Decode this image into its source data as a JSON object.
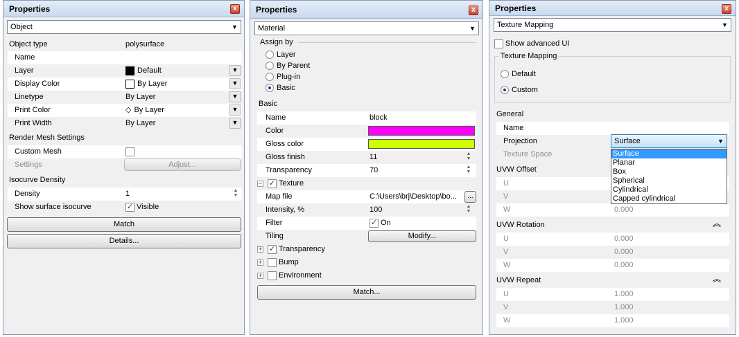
{
  "panel1": {
    "title": "Properties",
    "close": "x",
    "category": "Object",
    "object_type_label": "Object type",
    "object_type_value": "polysurface",
    "rows": [
      {
        "label": "Name",
        "value": ""
      },
      {
        "label": "Layer",
        "value": "Default"
      },
      {
        "label": "Display Color",
        "value": "By Layer"
      },
      {
        "label": "Linetype",
        "value": "By Layer"
      },
      {
        "label": "Print Color",
        "value": "By Layer"
      },
      {
        "label": "Print Width",
        "value": "By Layer"
      }
    ],
    "render_mesh_header": "Render Mesh Settings",
    "custom_mesh_label": "Custom Mesh",
    "settings_label": "Settings",
    "adjust_label": "Adjust...",
    "isocurve_header": "Isocurve Density",
    "density_label": "Density",
    "density_value": "1",
    "show_iso_label": "Show surface isocurve",
    "show_iso_value": "Visible",
    "match_label": "Match",
    "details_label": "Details...",
    "layer_color": "#000000"
  },
  "panel2": {
    "title": "Properties",
    "close": "x",
    "category": "Material",
    "assign_by_header": "Assign by",
    "assign_options": [
      "Layer",
      "By Parent",
      "Plug-in",
      "Basic"
    ],
    "basic_header": "Basic",
    "name_label": "Name",
    "name_value": "block",
    "color_label": "Color",
    "color_value": "#ff00ff",
    "gloss_color_label": "Gloss color",
    "gloss_color_value": "#ccff00",
    "gloss_finish_label": "Gloss finish",
    "gloss_finish_value": "11",
    "transparency_label": "Transparency",
    "transparency_value": "70",
    "texture_label": "Texture",
    "map_file_label": "Map file",
    "map_file_value": "C:\\Users\\brj\\Desktop\\bo...",
    "browse_label": "...",
    "intensity_label": "Intensity, %",
    "intensity_value": "100",
    "filter_label": "Filter",
    "filter_value": "On",
    "tiling_label": "Tiling",
    "modify_label": "Modify...",
    "tree_transparency": "Transparency",
    "tree_bump": "Bump",
    "tree_environment": "Environment",
    "match_label": "Match..."
  },
  "panel3": {
    "title": "Properties",
    "close": "x",
    "category": "Texture Mapping",
    "show_advanced": "Show advanced UI",
    "tm_group": "Texture Mapping",
    "tm_options": [
      "Default",
      "Custom"
    ],
    "general_header": "General",
    "name_label": "Name",
    "projection_label": "Projection",
    "projection_value": "Surface",
    "texture_space_label": "Texture Space",
    "projection_options": [
      "Surface",
      "Planar",
      "Box",
      "Spherical",
      "Cylindrical",
      "Capped cylindrical"
    ],
    "uvw_offset_header": "UVW Offset",
    "offset": [
      {
        "label": "U",
        "value": ""
      },
      {
        "label": "V",
        "value": ""
      },
      {
        "label": "W",
        "value": "0.000"
      }
    ],
    "uvw_rotation_header": "UVW Rotation",
    "rotation": [
      {
        "label": "U",
        "value": "0.000"
      },
      {
        "label": "V",
        "value": "0.000"
      },
      {
        "label": "W",
        "value": "0.000"
      }
    ],
    "uvw_repeat_header": "UVW Repeat",
    "repeat": [
      {
        "label": "U",
        "value": "1.000"
      },
      {
        "label": "V",
        "value": "1.000"
      },
      {
        "label": "W",
        "value": "1.000"
      }
    ],
    "collapse_glyph": "︽"
  }
}
